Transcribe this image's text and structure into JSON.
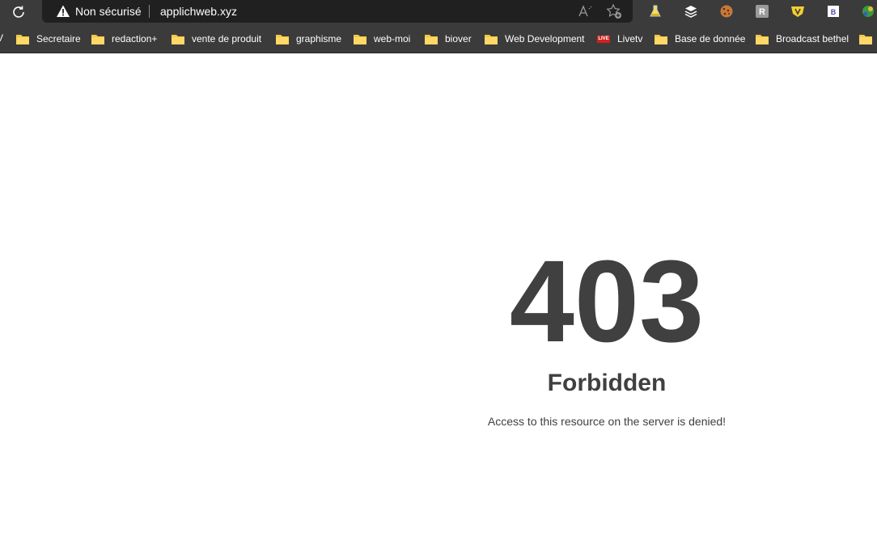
{
  "browser": {
    "security_label": "Non sécurisé",
    "url": "applichweb.xyz"
  },
  "bookmarks": {
    "partial_label": "V",
    "items": [
      {
        "label": "Secretaire",
        "icon": "folder-icon"
      },
      {
        "label": "redaction+",
        "icon": "folder-icon"
      },
      {
        "label": "vente de produit",
        "icon": "folder-icon"
      },
      {
        "label": "graphisme",
        "icon": "folder-icon"
      },
      {
        "label": "web-moi",
        "icon": "folder-icon"
      },
      {
        "label": "biover",
        "icon": "folder-icon"
      },
      {
        "label": "Web Development",
        "icon": "folder-icon"
      },
      {
        "label": "Livetv",
        "icon": "live-icon",
        "badge": "LIVE"
      },
      {
        "label": "Base de donnée",
        "icon": "folder-icon"
      },
      {
        "label": "Broadcast bethel",
        "icon": "folder-icon"
      }
    ]
  },
  "error": {
    "code": "403",
    "title": "Forbidden",
    "message": "Access to this resource on the server is denied!"
  },
  "colors": {
    "toolbar_bg": "#3b3b3b",
    "omnibox_bg": "#202020",
    "folder": "#f4c64a",
    "error_text": "#404040"
  }
}
